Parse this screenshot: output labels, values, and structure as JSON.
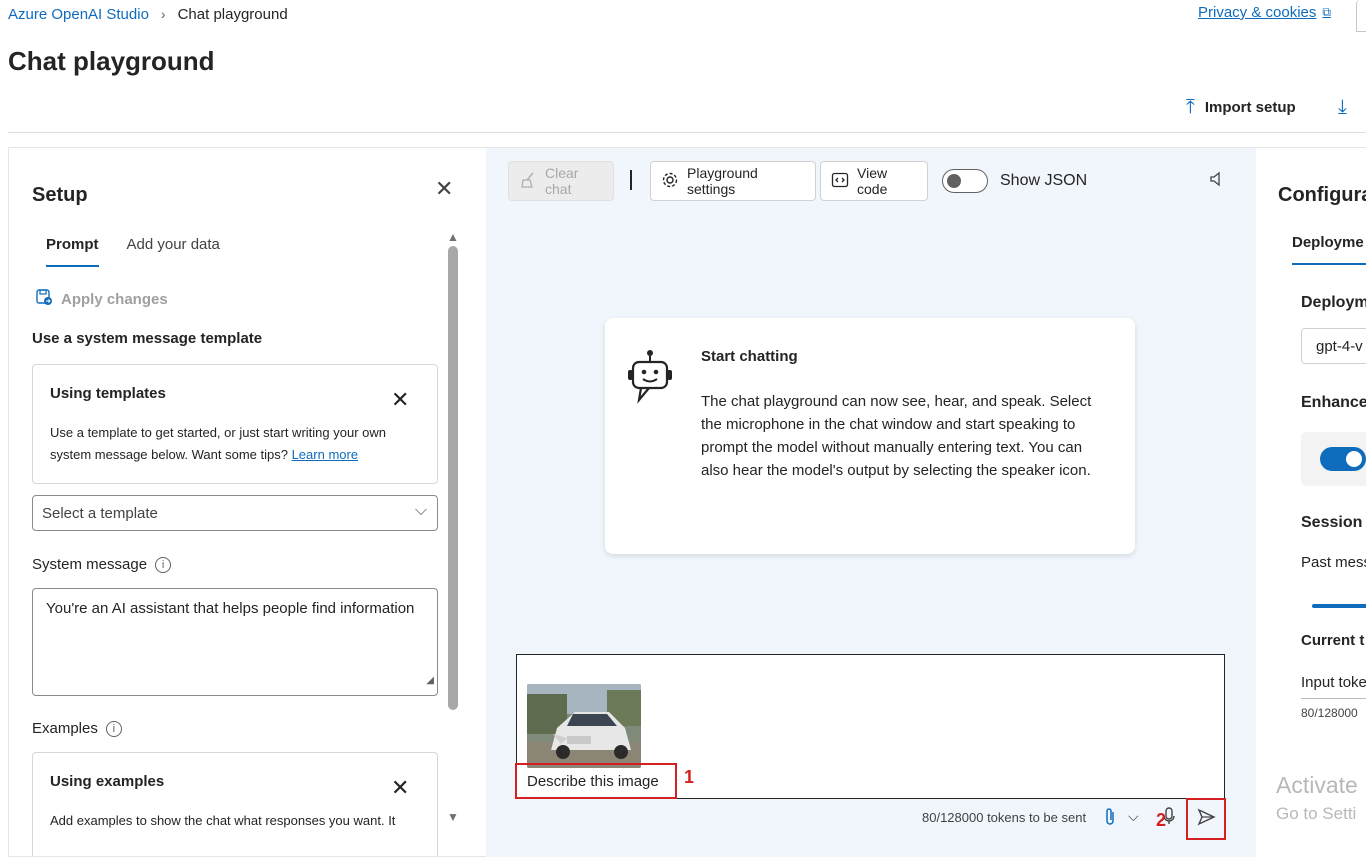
{
  "breadcrumb": {
    "root": "Azure OpenAI Studio",
    "current": "Chat playground"
  },
  "header": {
    "privacy_link": "Privacy & cookies",
    "page_title": "Chat playground",
    "import_setup": "Import setup"
  },
  "setup": {
    "title": "Setup",
    "tabs": [
      "Prompt",
      "Add your data"
    ],
    "apply_changes": "Apply changes",
    "template_heading": "Use a system message template",
    "templates_card": {
      "title": "Using templates",
      "body": "Use a template to get started, or just start writing your own system message below. Want some tips?",
      "link": "Learn more"
    },
    "template_select_placeholder": "Select a template",
    "system_message_label": "System message",
    "system_message_value": "You're an AI assistant that helps people find information",
    "examples_label": "Examples",
    "examples_card": {
      "title": "Using examples",
      "body": "Add examples to show the chat what responses you want. It"
    }
  },
  "chat": {
    "toolbar": {
      "clear_chat": "Clear chat",
      "playground_settings": "Playground settings",
      "view_code": "View code",
      "show_json": "Show JSON"
    },
    "start_card": {
      "title": "Start chatting",
      "body": "The chat playground can now see, hear, and speak. Select the microphone in the chat window and start speaking to prompt the model without manually entering text. You can also hear the model's output by selecting the speaker icon."
    },
    "input": {
      "prompt_text": "Describe this image",
      "annotation_1": "1",
      "annotation_2": "2"
    },
    "token_count": "80/128000 tokens to be sent"
  },
  "configuration": {
    "title": "Configura",
    "tab": "Deployme",
    "deployment_label": "Deploym",
    "deployment_value": "gpt-4-v",
    "enhance_label": "Enhance",
    "session_label": "Session",
    "past_messages": "Past mess",
    "current_label": "Current t",
    "input_tokens": "Input toke",
    "input_tokens_value": "80/128000"
  },
  "watermark": {
    "line1": "Activate",
    "line2": "Go to Setti"
  },
  "colors": {
    "accent": "#0f6cbd",
    "annotation": "#d42020",
    "chat_bg": "#f1f6fd"
  }
}
